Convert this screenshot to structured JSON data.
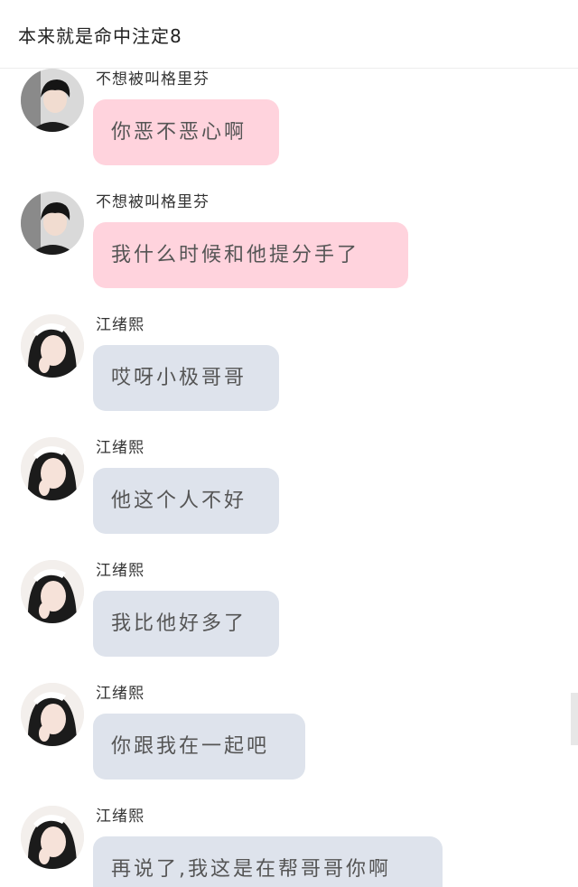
{
  "header": {
    "title": "本来就是命中注定8"
  },
  "messages": [
    {
      "sender": "不想被叫格里芬",
      "text": "你恶不恶心啊",
      "avatar_icon": "boy-avatar",
      "bubble_color": "#ffd3dd"
    },
    {
      "sender": "不想被叫格里芬",
      "text": "我什么时候和他提分手了",
      "avatar_icon": "boy-avatar",
      "bubble_color": "#ffd3dd"
    },
    {
      "sender": "江绪熙",
      "text": "哎呀小极哥哥",
      "avatar_icon": "girl-avatar",
      "bubble_color": "#dee3ec"
    },
    {
      "sender": "江绪熙",
      "text": "他这个人不好",
      "avatar_icon": "girl-avatar",
      "bubble_color": "#dee3ec"
    },
    {
      "sender": "江绪熙",
      "text": "我比他好多了",
      "avatar_icon": "girl-avatar",
      "bubble_color": "#dee3ec"
    },
    {
      "sender": "江绪熙",
      "text": "你跟我在一起吧",
      "avatar_icon": "girl-avatar",
      "bubble_color": "#dee3ec"
    },
    {
      "sender": "江绪熙",
      "text": "再说了,我这是在帮哥哥你啊",
      "avatar_icon": "girl-avatar",
      "bubble_color": "#dee3ec"
    }
  ]
}
